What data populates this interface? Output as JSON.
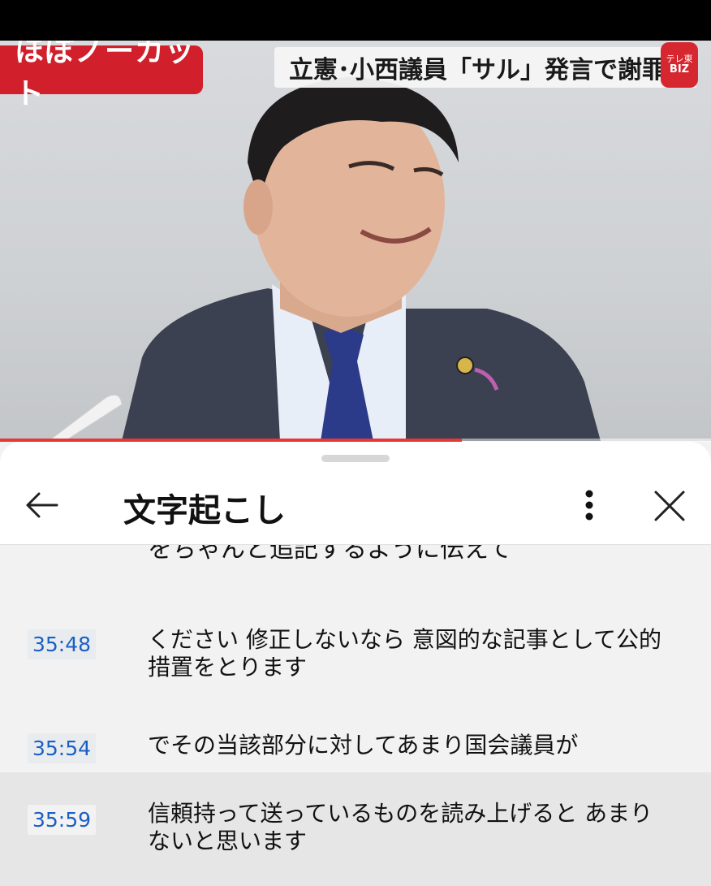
{
  "video": {
    "badge": "ほぼノーカット",
    "headline": "立憲･小西議員「サル」発言で謝罪",
    "logo_line1": "テレ東",
    "logo_line2": "BIZ",
    "progress_fraction": 0.65
  },
  "panel": {
    "title": "文字起こし",
    "back_icon": "arrow-left-icon",
    "more_icon": "vertical-ellipsis-icon",
    "close_icon": "close-icon"
  },
  "transcript": {
    "partial_text": "をちゃんと追記するように伝えて",
    "segments": [
      {
        "time": "35:48",
        "text": "ください 修正しないなら 意図的な記事として公的措置をとります"
      },
      {
        "time": "35:54",
        "text": "でその当該部分に対してあまり国会議員が"
      },
      {
        "time": "35:59",
        "text": "信頼持って送っているものを読み上げると あまりないと思います"
      }
    ]
  },
  "colors": {
    "accent_red": "#d1202b",
    "timestamp_blue": "#1a5fc4"
  }
}
